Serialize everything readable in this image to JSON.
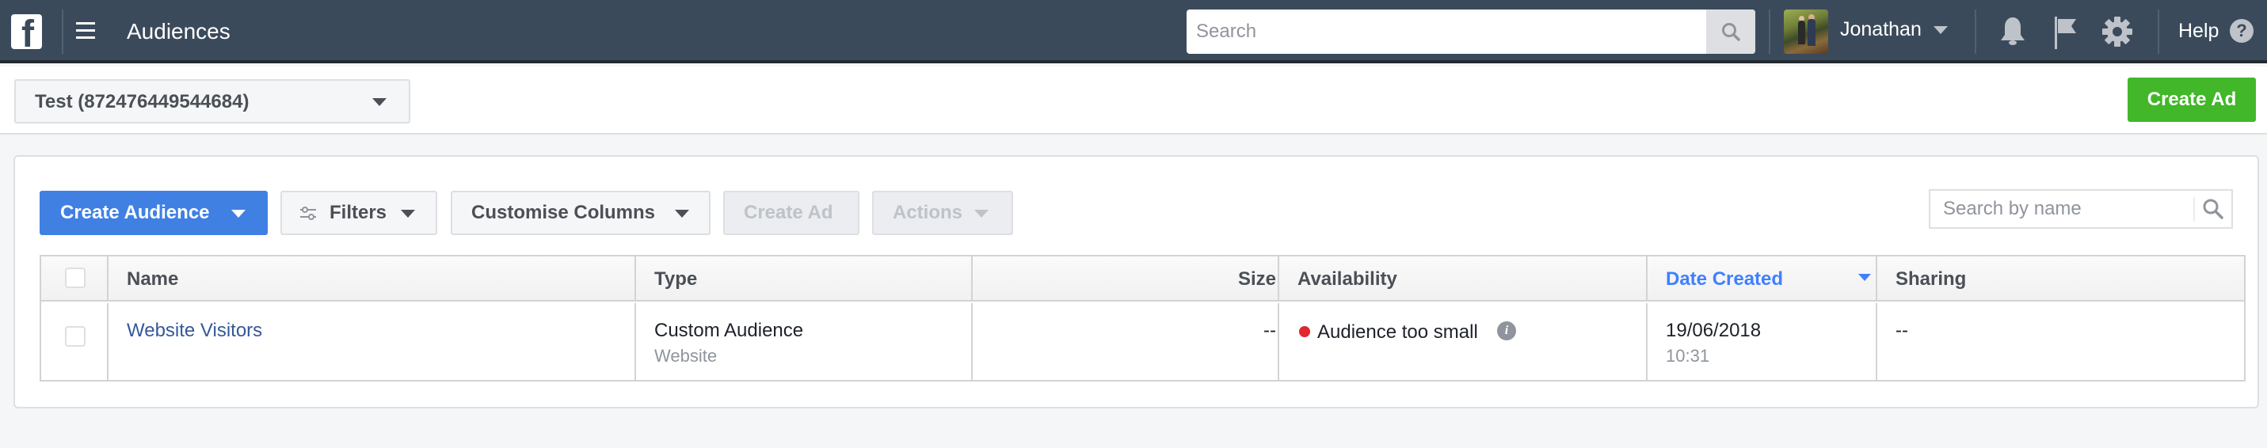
{
  "header": {
    "logo": "f",
    "app_title": "Audiences",
    "search_placeholder": "Search",
    "user_name": "Jonathan",
    "help_label": "Help",
    "help_icon_glyph": "?",
    "icons": [
      "facebook-logo-icon",
      "hamburger-menu-icon",
      "search-icon",
      "avatar",
      "chevron-down-icon",
      "bell-icon",
      "flag-icon",
      "gear-icon",
      "help-icon"
    ]
  },
  "account_bar": {
    "account_selected": "Test (872476449544684)",
    "create_ad_label": "Create Ad"
  },
  "toolbar": {
    "create_audience_label": "Create Audience",
    "filters_label": "Filters",
    "customise_columns_label": "Customise Columns",
    "create_ad_label": "Create Ad",
    "actions_label": "Actions",
    "search_placeholder": "Search by name"
  },
  "table": {
    "columns": [
      "Name",
      "Type",
      "Size",
      "Availability",
      "Date Created",
      "Sharing"
    ],
    "sorted_column": "Date Created",
    "rows": [
      {
        "name": "Website Visitors",
        "type": "Custom Audience",
        "subtype": "Website",
        "size": "--",
        "availability": "Audience too small",
        "availability_status_color": "#e0262e",
        "date": "19/06/2018",
        "time": "10:31",
        "sharing": "--"
      }
    ]
  },
  "colors": {
    "header_bg": "#3b4a5b",
    "primary_blue": "#4080e3",
    "green": "#42b72a",
    "link": "#365899",
    "sort_active": "#4080ff"
  }
}
